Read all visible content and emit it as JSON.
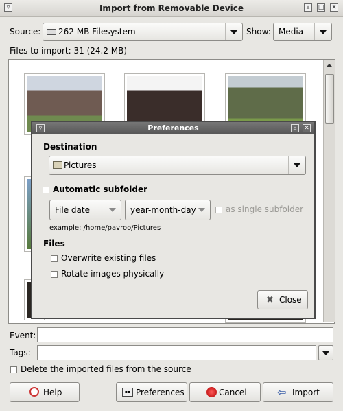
{
  "window": {
    "title": "Import from Removable Device"
  },
  "source": {
    "label": "Source:",
    "value": "262 MB Filesystem"
  },
  "show": {
    "label": "Show:",
    "value": "Media"
  },
  "files_to_import": "Files to import: 31 (24.2 MB)",
  "dialog": {
    "title": "Preferences",
    "destination": {
      "heading": "Destination",
      "value": "Pictures"
    },
    "subfolder": {
      "label": "Automatic subfolder",
      "type_value": "File date",
      "format_value": "year-month-day",
      "single_label": "as single subfolder",
      "example": "example: /home/pavroo/Pictures"
    },
    "files": {
      "heading": "Files",
      "overwrite": "Overwrite existing files",
      "rotate": "Rotate images physically"
    },
    "close_label": "Close"
  },
  "event": {
    "label": "Event:",
    "value": ""
  },
  "tags": {
    "label": "Tags:",
    "value": ""
  },
  "delete_label": "Delete the imported files from the source",
  "buttons": {
    "help": "Help",
    "preferences": "Preferences",
    "cancel": "Cancel",
    "import": "Import"
  },
  "colors": {
    "dialog_title": "#5a5a5a",
    "window_bg": "#e8e7e3"
  }
}
